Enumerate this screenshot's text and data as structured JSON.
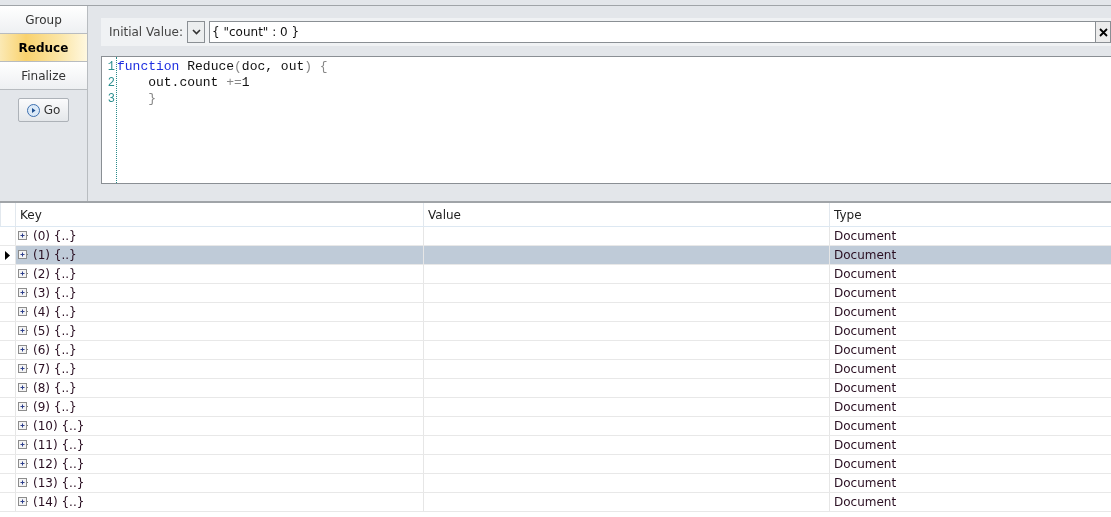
{
  "tabs": [
    {
      "label": "Group",
      "selected": false
    },
    {
      "label": "Reduce",
      "selected": true
    },
    {
      "label": "Finalize",
      "selected": false
    }
  ],
  "go_button": {
    "label": "Go"
  },
  "initial_value": {
    "label": "Initial Value:",
    "value": "{ \"count\" : 0 }"
  },
  "editor": {
    "lines": [
      {
        "number": "1",
        "tokens": [
          {
            "text": "function",
            "kind": "keyword"
          },
          {
            "text": " Reduce",
            "kind": "plain"
          },
          {
            "text": "(",
            "kind": "punct"
          },
          {
            "text": "doc, out",
            "kind": "plain"
          },
          {
            "text": ") {",
            "kind": "punct"
          }
        ]
      },
      {
        "number": "2",
        "tokens": [
          {
            "text": "    out.count ",
            "kind": "plain"
          },
          {
            "text": "+=",
            "kind": "punct"
          },
          {
            "text": "1",
            "kind": "plain"
          }
        ]
      },
      {
        "number": "3",
        "tokens": [
          {
            "text": "    }",
            "kind": "punct"
          }
        ]
      }
    ]
  },
  "table": {
    "columns": [
      "Key",
      "Value",
      "Type"
    ],
    "rows": [
      {
        "key": "(0) {..}",
        "type": "Document",
        "selected": false
      },
      {
        "key": "(1) {..}",
        "type": "Document",
        "selected": true
      },
      {
        "key": "(2) {..}",
        "type": "Document",
        "selected": false
      },
      {
        "key": "(3) {..}",
        "type": "Document",
        "selected": false
      },
      {
        "key": "(4) {..}",
        "type": "Document",
        "selected": false
      },
      {
        "key": "(5) {..}",
        "type": "Document",
        "selected": false
      },
      {
        "key": "(6) {..}",
        "type": "Document",
        "selected": false
      },
      {
        "key": "(7) {..}",
        "type": "Document",
        "selected": false
      },
      {
        "key": "(8) {..}",
        "type": "Document",
        "selected": false
      },
      {
        "key": "(9) {..}",
        "type": "Document",
        "selected": false
      },
      {
        "key": "(10) {..}",
        "type": "Document",
        "selected": false
      },
      {
        "key": "(11) {..}",
        "type": "Document",
        "selected": false
      },
      {
        "key": "(12) {..}",
        "type": "Document",
        "selected": false
      },
      {
        "key": "(13) {..}",
        "type": "Document",
        "selected": false
      },
      {
        "key": "(14) {..}",
        "type": "Document",
        "selected": false
      }
    ]
  }
}
